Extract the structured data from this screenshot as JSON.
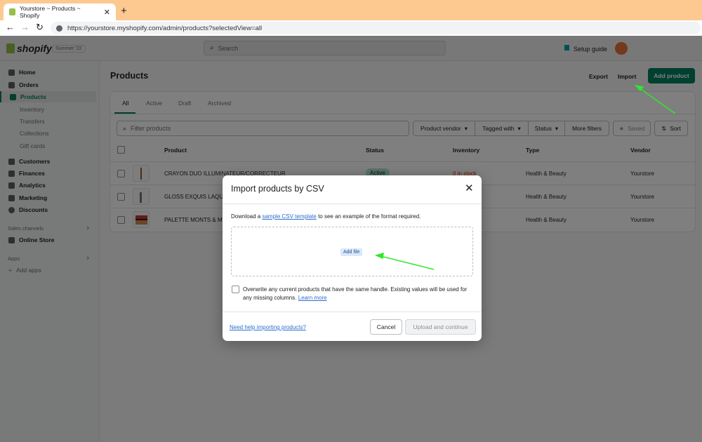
{
  "browser": {
    "tab_title": "Yourstore ~ Products ~ Shopify",
    "url": "https://yourstore.myshopify.com/admin/products?selectedView=all"
  },
  "topbar": {
    "logo": "shopify",
    "badge": "Summer '22",
    "search_placeholder": "Search",
    "setup_guide": "Setup guide"
  },
  "sidebar": {
    "items": [
      {
        "label": "Home"
      },
      {
        "label": "Orders"
      },
      {
        "label": "Products"
      },
      {
        "label": "Inventory"
      },
      {
        "label": "Transfers"
      },
      {
        "label": "Collections"
      },
      {
        "label": "Gift cards"
      },
      {
        "label": "Customers"
      },
      {
        "label": "Finances"
      },
      {
        "label": "Analytics"
      },
      {
        "label": "Marketing"
      },
      {
        "label": "Discounts"
      }
    ],
    "sales_channels": "Sales channels",
    "online_store": "Online Store",
    "apps": "Apps",
    "add_apps": "Add apps"
  },
  "page": {
    "title": "Products",
    "export": "Export",
    "import": "Import",
    "add_product": "Add product"
  },
  "tabs": [
    "All",
    "Active",
    "Draft",
    "Archived"
  ],
  "filters": {
    "placeholder": "Filter products",
    "vendor": "Product vendor",
    "tagged": "Tagged with",
    "status": "Status",
    "more": "More filters",
    "saved": "Saved",
    "sort": "Sort"
  },
  "table": {
    "headers": [
      "Product",
      "Status",
      "Inventory",
      "Type",
      "Vendor"
    ],
    "rows": [
      {
        "product": "CRAYON DUO ILLUMINATEUR/CORRECTEUR",
        "status": "Active",
        "inventory": "0 in stock",
        "type": "Health & Beauty",
        "vendor": "Yourstore"
      },
      {
        "product": "GLOSS EXQUIS LAQUE",
        "type": "Health & Beauty",
        "vendor": "Yourstore"
      },
      {
        "product": "PALETTE MONTS & M",
        "type": "Health & Beauty",
        "vendor": "Yourstore"
      }
    ]
  },
  "modal": {
    "title": "Import products by CSV",
    "desc_pre": "Download a ",
    "desc_link": "sample CSV template",
    "desc_post": " to see an example of the format required.",
    "add_file": "Add file",
    "overwrite": "Overwrite any current products that have the same handle. Existing values will be used for any missing columns. ",
    "learn_more": "Learn more",
    "help": "Need help importing products?",
    "cancel": "Cancel",
    "upload": "Upload and continue"
  },
  "colors": {
    "accent": "#008060",
    "annotation_arrow": "#2ee82e",
    "tab_bar": "#fdc990"
  }
}
